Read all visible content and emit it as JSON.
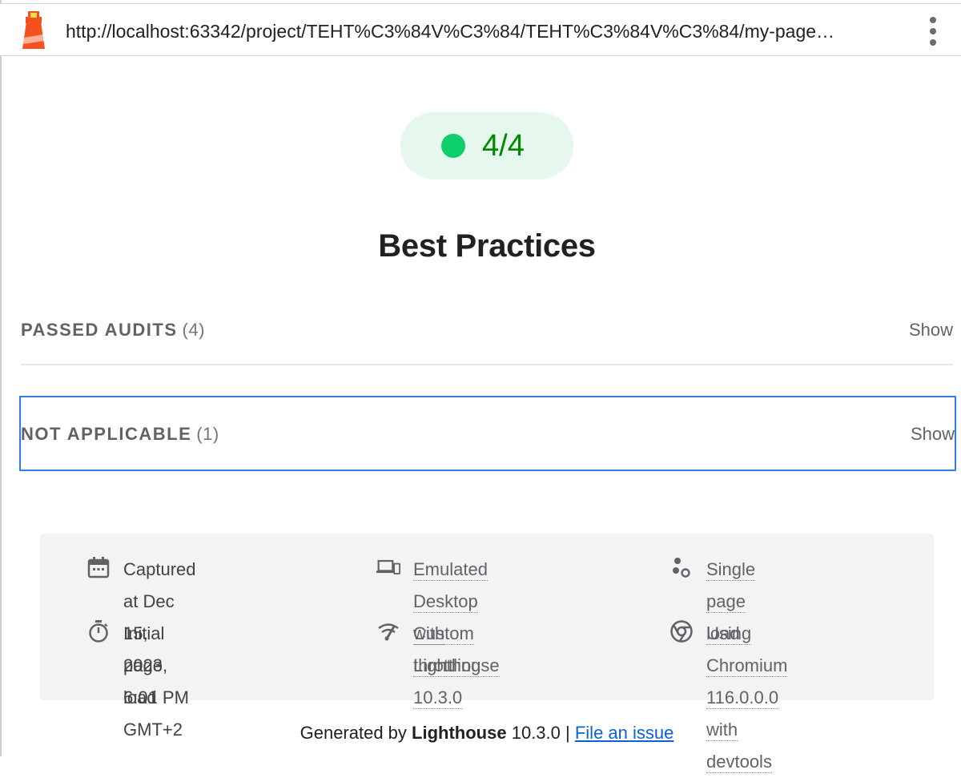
{
  "browser": {
    "url": "http://localhost:63342/project/TEHT%C3%84V%C3%84/TEHT%C3%84V%C3%84/my-page…"
  },
  "gauge": {
    "score": "4/4",
    "color": "#0cce6b",
    "text_color": "#008800"
  },
  "category": {
    "title": "Best Practices"
  },
  "groups": [
    {
      "label": "PASSED AUDITS",
      "count": "(4)",
      "toggle": "Show"
    },
    {
      "label": "NOT APPLICABLE",
      "count": "(1)",
      "toggle": "Show"
    }
  ],
  "runtime": {
    "captured": "Captured at Dec 15, 2023, 6:01 PM GMT+2",
    "captured_line1": "Captured at Dec 15,",
    "captured_line2": "2023, 6:01 PM GMT+2",
    "initial_load": "Initial page load",
    "emulated_line1": "Emulated Desktop with",
    "emulated_line2": "Lighthouse 10.3.0",
    "throttling": "Custom throttling",
    "single_load": "Single page load",
    "chromium_line1": "Using Chromium",
    "chromium_line2": "116.0.0.0 with devtools",
    "icons": [
      "calendar-icon",
      "stopwatch-icon",
      "devices-icon",
      "throttling-icon",
      "single-load-icon",
      "chrome-icon"
    ]
  },
  "footer": {
    "generated_by": "Generated by",
    "product": "Lighthouse",
    "version": "10.3.0",
    "separator": "|",
    "issue_link": "File an issue"
  }
}
